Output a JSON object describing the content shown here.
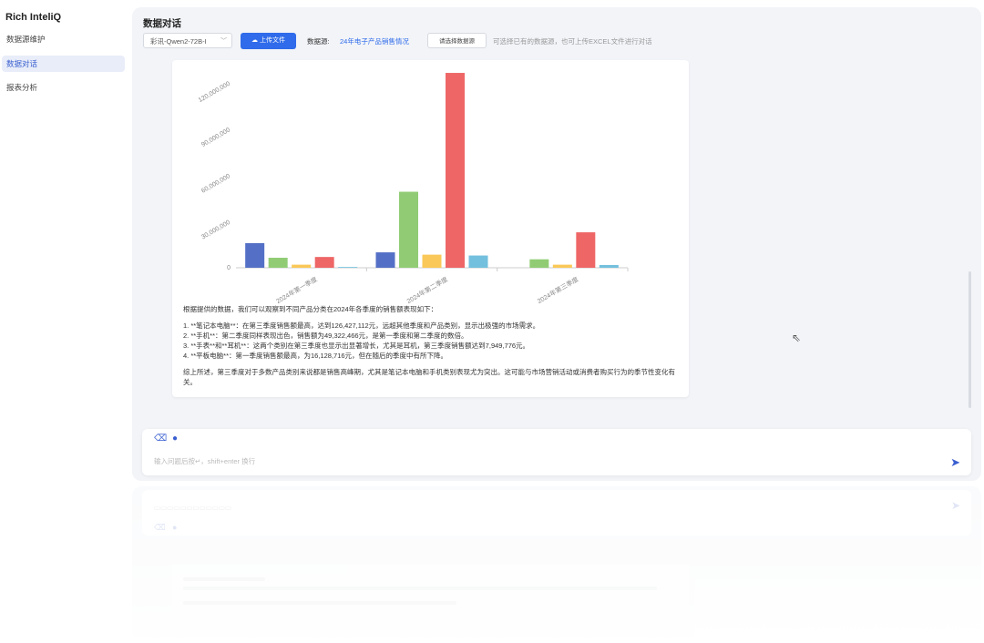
{
  "app": {
    "brand": "Rich InteliQ"
  },
  "sidebar": {
    "items": [
      {
        "label": "数据源维护"
      },
      {
        "label": "数据对话"
      },
      {
        "label": "报表分析"
      }
    ]
  },
  "page": {
    "title": "数据对话"
  },
  "toolbar": {
    "model": "彩讯-Qwen2-72B-I",
    "upload_label": "上传文件",
    "datasource_label": "数据源:",
    "datasource_value": "24年电子产品销售情况",
    "choose_label": "请选择数据源",
    "hint": "可选择已有的数据源，也可上传EXCEL文件进行对话"
  },
  "chart_data": {
    "type": "bar",
    "categories": [
      "2024年第一季度",
      "2024年第二季度",
      "2024年第三季度"
    ],
    "ylim": [
      0,
      130000000
    ],
    "ytick_values": [
      0,
      30000000,
      60000000,
      90000000,
      120000000
    ],
    "ytick_labels": [
      "0",
      "30,000,000",
      "60,000,000",
      "90,000,000",
      "120,000,000"
    ],
    "colors": [
      "#5470c6",
      "#91cc75",
      "#fac858",
      "#ee6666",
      "#73c0de"
    ],
    "series": [
      {
        "values": [
          16000000,
          10000000,
          0
        ]
      },
      {
        "values": [
          6500000,
          49322466,
          5500000
        ]
      },
      {
        "values": [
          2000000,
          8500000,
          2000000
        ]
      },
      {
        "values": [
          7000000,
          126427112,
          23000000
        ]
      },
      {
        "values": [
          500000,
          7949776,
          1800000
        ]
      }
    ]
  },
  "answer": {
    "intro": "根据提供的数据，我们可以观察到不同产品分类在2024年各季度的销售额表现如下：",
    "points": [
      "1. **笔记本电脑**：在第三季度销售额最高，达到126,427,112元，远超其他季度和产品类别，显示出极强的市场需求。",
      "2. **手机**：第二季度同样表现出色，销售额为49,322,466元，是第一季度和第二季度的数倍。",
      "3. **手表**和**耳机**：这两个类别在第三季度也显示出显著增长，尤其是耳机，第三季度销售额达到7,949,776元。",
      "4. **平板电脑**：第一季度销售额最高，为16,128,716元，但在随后的季度中有所下降。"
    ],
    "conclusion": "综上所述，第三季度对于多数产品类别来说都是销售高峰期，尤其是笔记本电脑和手机类别表现尤为突出。这可能与市场营销活动或消费者购买行为的季节性变化有关。"
  },
  "input": {
    "placeholder": "输入问题后按↵，shift+enter 换行"
  },
  "icons": {
    "upload": "cloud-upload-icon",
    "clear": "eraser-icon",
    "mic": "microphone-icon",
    "send": "send-icon",
    "cursor": "mouse-pointer-icon"
  }
}
